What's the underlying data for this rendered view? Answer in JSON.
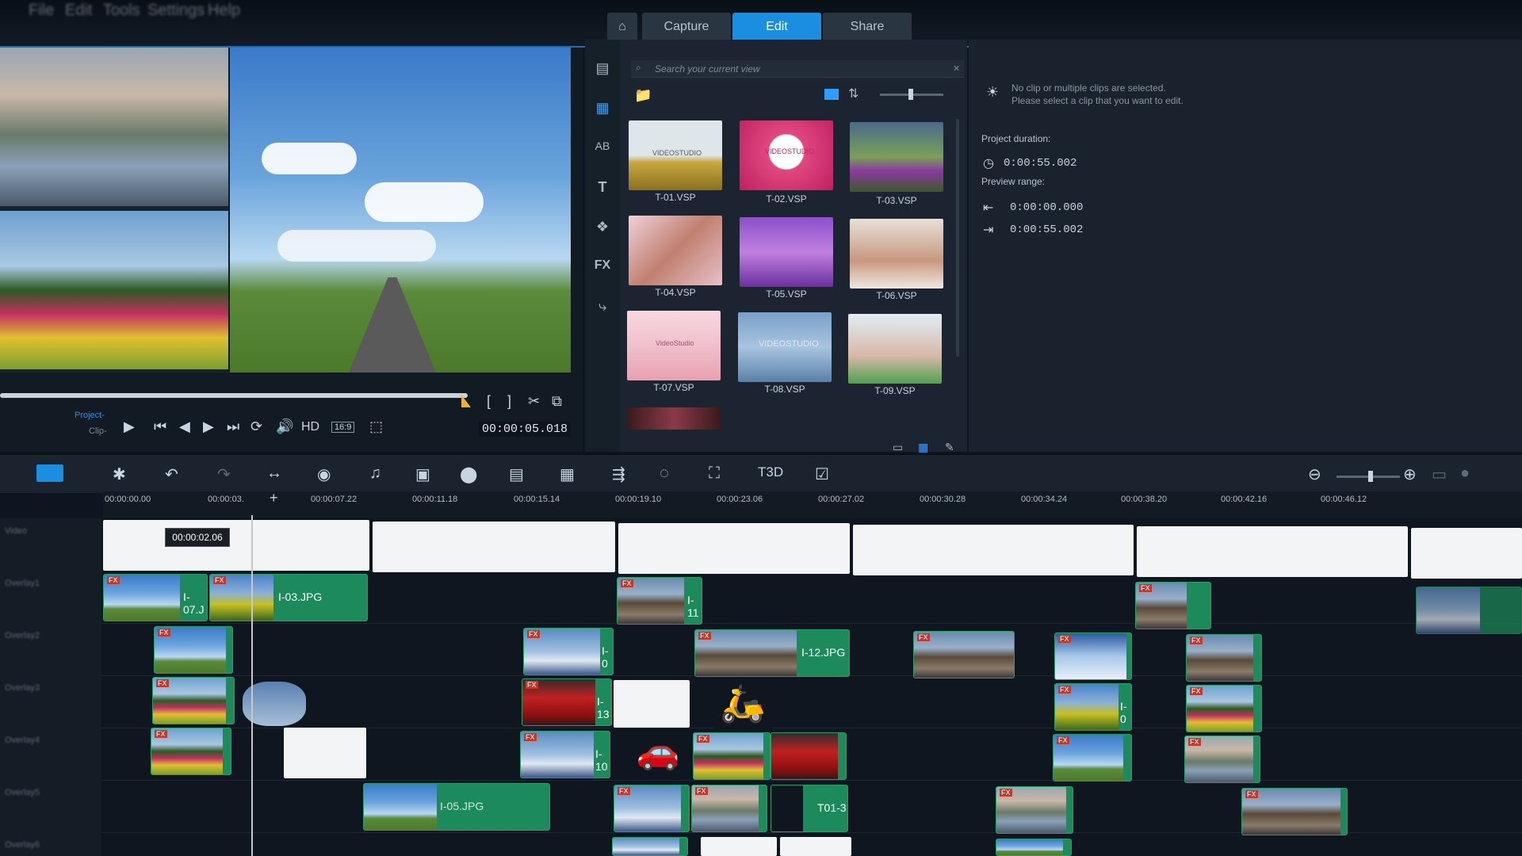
{
  "menu": [
    "File",
    "Edit",
    "Tools",
    "Settings",
    "Help"
  ],
  "tabs": {
    "home_icon": "home-icon",
    "capture": "Capture",
    "edit": "Edit",
    "share": "Share"
  },
  "preview": {
    "mode_project": "Project-",
    "mode_clip": "Clip-",
    "hd": "HD",
    "aspect": "16:9",
    "timecode": "00:00:05.018"
  },
  "library": {
    "search_placeholder": "Search your current view",
    "items": [
      {
        "label": "T-01.VSP",
        "thumb_text": "VIDEOSTUDIO"
      },
      {
        "label": "T-02.VSP",
        "thumb_text": "VIDEOSTUDIO"
      },
      {
        "label": "T-03.VSP"
      },
      {
        "label": "T-04.VSP"
      },
      {
        "label": "T-05.VSP"
      },
      {
        "label": "T-06.VSP"
      },
      {
        "label": "T-07.VSP",
        "thumb_text": "VideoStudio"
      },
      {
        "label": "T-08.VSP",
        "thumb_text": "VIDEOSTUDIO"
      },
      {
        "label": "T-09.VSP"
      }
    ]
  },
  "options": {
    "notice_line1": "No clip or multiple clips are selected.",
    "notice_line2": "Please select a clip that you want to edit.",
    "project_duration_label": "Project duration:",
    "project_duration": "0:00:55.002",
    "preview_range_label": "Preview range:",
    "range_start": "0:00:00.000",
    "range_end": "0:00:55.002"
  },
  "timeline": {
    "ruler": [
      "00:00:00.00",
      "00:00:03.",
      "00:00:07.22",
      "00:00:11.18",
      "00:00:15.14",
      "00:00:19.10",
      "00:00:23.06",
      "00:00:27.02",
      "00:00:30.28",
      "00:00:34.24",
      "00:00:38.20",
      "00:00:42.16",
      "00:00:46.12"
    ],
    "tooltip": "00:00:02.06",
    "track_labels": [
      "Video",
      "Overlay1",
      "Overlay2",
      "Overlay3",
      "Overlay4",
      "Overlay5",
      "Overlay6"
    ],
    "clip_labels": {
      "c1": "I-07.J",
      "c2": "I-03.JPG",
      "c3": "I-11",
      "c4": "I-0",
      "c5": "I-12.JPG",
      "c6": "I-13",
      "c7": "I-0",
      "c8": "I-10",
      "c9": "I-05.JPG",
      "c10": "T01-3"
    },
    "fx": "FX"
  }
}
